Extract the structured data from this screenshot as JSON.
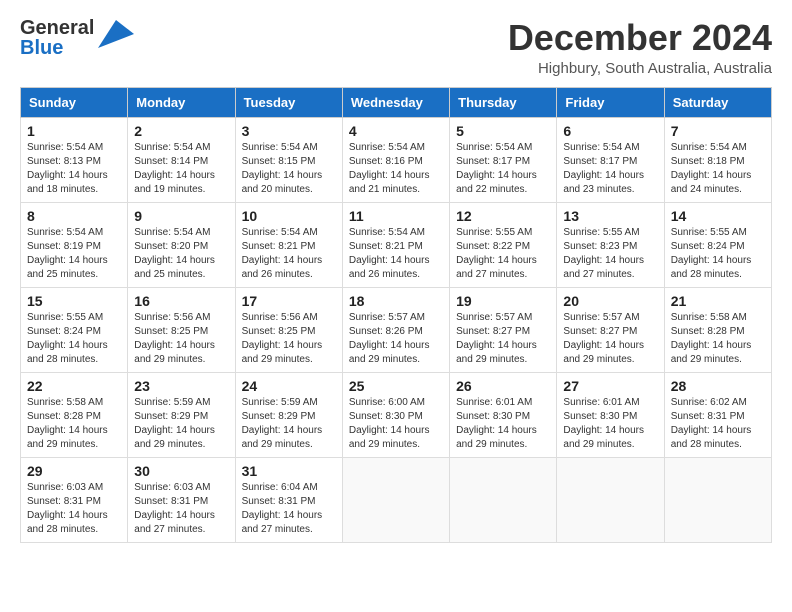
{
  "header": {
    "logo_general": "General",
    "logo_blue": "Blue",
    "month_title": "December 2024",
    "subtitle": "Highbury, South Australia, Australia"
  },
  "calendar": {
    "days_of_week": [
      "Sunday",
      "Monday",
      "Tuesday",
      "Wednesday",
      "Thursday",
      "Friday",
      "Saturday"
    ],
    "weeks": [
      [
        {
          "day": "",
          "empty": true
        },
        {
          "day": "2",
          "sunrise": "Sunrise: 5:54 AM",
          "sunset": "Sunset: 8:14 PM",
          "daylight": "Daylight: 14 hours and 19 minutes."
        },
        {
          "day": "3",
          "sunrise": "Sunrise: 5:54 AM",
          "sunset": "Sunset: 8:15 PM",
          "daylight": "Daylight: 14 hours and 20 minutes."
        },
        {
          "day": "4",
          "sunrise": "Sunrise: 5:54 AM",
          "sunset": "Sunset: 8:16 PM",
          "daylight": "Daylight: 14 hours and 21 minutes."
        },
        {
          "day": "5",
          "sunrise": "Sunrise: 5:54 AM",
          "sunset": "Sunset: 8:17 PM",
          "daylight": "Daylight: 14 hours and 22 minutes."
        },
        {
          "day": "6",
          "sunrise": "Sunrise: 5:54 AM",
          "sunset": "Sunset: 8:17 PM",
          "daylight": "Daylight: 14 hours and 23 minutes."
        },
        {
          "day": "7",
          "sunrise": "Sunrise: 5:54 AM",
          "sunset": "Sunset: 8:18 PM",
          "daylight": "Daylight: 14 hours and 24 minutes."
        }
      ],
      [
        {
          "day": "1",
          "sunrise": "Sunrise: 5:54 AM",
          "sunset": "Sunset: 8:13 PM",
          "daylight": "Daylight: 14 hours and 18 minutes."
        },
        {
          "day": "9",
          "sunrise": "Sunrise: 5:54 AM",
          "sunset": "Sunset: 8:20 PM",
          "daylight": "Daylight: 14 hours and 25 minutes."
        },
        {
          "day": "10",
          "sunrise": "Sunrise: 5:54 AM",
          "sunset": "Sunset: 8:21 PM",
          "daylight": "Daylight: 14 hours and 26 minutes."
        },
        {
          "day": "11",
          "sunrise": "Sunrise: 5:54 AM",
          "sunset": "Sunset: 8:21 PM",
          "daylight": "Daylight: 14 hours and 26 minutes."
        },
        {
          "day": "12",
          "sunrise": "Sunrise: 5:55 AM",
          "sunset": "Sunset: 8:22 PM",
          "daylight": "Daylight: 14 hours and 27 minutes."
        },
        {
          "day": "13",
          "sunrise": "Sunrise: 5:55 AM",
          "sunset": "Sunset: 8:23 PM",
          "daylight": "Daylight: 14 hours and 27 minutes."
        },
        {
          "day": "14",
          "sunrise": "Sunrise: 5:55 AM",
          "sunset": "Sunset: 8:24 PM",
          "daylight": "Daylight: 14 hours and 28 minutes."
        }
      ],
      [
        {
          "day": "8",
          "sunrise": "Sunrise: 5:54 AM",
          "sunset": "Sunset: 8:19 PM",
          "daylight": "Daylight: 14 hours and 25 minutes."
        },
        {
          "day": "16",
          "sunrise": "Sunrise: 5:56 AM",
          "sunset": "Sunset: 8:25 PM",
          "daylight": "Daylight: 14 hours and 29 minutes."
        },
        {
          "day": "17",
          "sunrise": "Sunrise: 5:56 AM",
          "sunset": "Sunset: 8:25 PM",
          "daylight": "Daylight: 14 hours and 29 minutes."
        },
        {
          "day": "18",
          "sunrise": "Sunrise: 5:57 AM",
          "sunset": "Sunset: 8:26 PM",
          "daylight": "Daylight: 14 hours and 29 minutes."
        },
        {
          "day": "19",
          "sunrise": "Sunrise: 5:57 AM",
          "sunset": "Sunset: 8:27 PM",
          "daylight": "Daylight: 14 hours and 29 minutes."
        },
        {
          "day": "20",
          "sunrise": "Sunrise: 5:57 AM",
          "sunset": "Sunset: 8:27 PM",
          "daylight": "Daylight: 14 hours and 29 minutes."
        },
        {
          "day": "21",
          "sunrise": "Sunrise: 5:58 AM",
          "sunset": "Sunset: 8:28 PM",
          "daylight": "Daylight: 14 hours and 29 minutes."
        }
      ],
      [
        {
          "day": "15",
          "sunrise": "Sunrise: 5:55 AM",
          "sunset": "Sunset: 8:24 PM",
          "daylight": "Daylight: 14 hours and 28 minutes."
        },
        {
          "day": "23",
          "sunrise": "Sunrise: 5:59 AM",
          "sunset": "Sunset: 8:29 PM",
          "daylight": "Daylight: 14 hours and 29 minutes."
        },
        {
          "day": "24",
          "sunrise": "Sunrise: 5:59 AM",
          "sunset": "Sunset: 8:29 PM",
          "daylight": "Daylight: 14 hours and 29 minutes."
        },
        {
          "day": "25",
          "sunrise": "Sunrise: 6:00 AM",
          "sunset": "Sunset: 8:30 PM",
          "daylight": "Daylight: 14 hours and 29 minutes."
        },
        {
          "day": "26",
          "sunrise": "Sunrise: 6:01 AM",
          "sunset": "Sunset: 8:30 PM",
          "daylight": "Daylight: 14 hours and 29 minutes."
        },
        {
          "day": "27",
          "sunrise": "Sunrise: 6:01 AM",
          "sunset": "Sunset: 8:30 PM",
          "daylight": "Daylight: 14 hours and 29 minutes."
        },
        {
          "day": "28",
          "sunrise": "Sunrise: 6:02 AM",
          "sunset": "Sunset: 8:31 PM",
          "daylight": "Daylight: 14 hours and 28 minutes."
        }
      ],
      [
        {
          "day": "22",
          "sunrise": "Sunrise: 5:58 AM",
          "sunset": "Sunset: 8:28 PM",
          "daylight": "Daylight: 14 hours and 29 minutes."
        },
        {
          "day": "30",
          "sunrise": "Sunrise: 6:03 AM",
          "sunset": "Sunset: 8:31 PM",
          "daylight": "Daylight: 14 hours and 27 minutes."
        },
        {
          "day": "31",
          "sunrise": "Sunrise: 6:04 AM",
          "sunset": "Sunset: 8:31 PM",
          "daylight": "Daylight: 14 hours and 27 minutes."
        },
        {
          "day": "",
          "empty": true
        },
        {
          "day": "",
          "empty": true
        },
        {
          "day": "",
          "empty": true
        },
        {
          "day": "",
          "empty": true
        }
      ],
      [
        {
          "day": "29",
          "sunrise": "Sunrise: 6:03 AM",
          "sunset": "Sunset: 8:31 PM",
          "daylight": "Daylight: 14 hours and 28 minutes."
        },
        {
          "day": "",
          "empty": true
        },
        {
          "day": "",
          "empty": true
        },
        {
          "day": "",
          "empty": true
        },
        {
          "day": "",
          "empty": true
        },
        {
          "day": "",
          "empty": true
        },
        {
          "day": "",
          "empty": true
        }
      ]
    ]
  }
}
